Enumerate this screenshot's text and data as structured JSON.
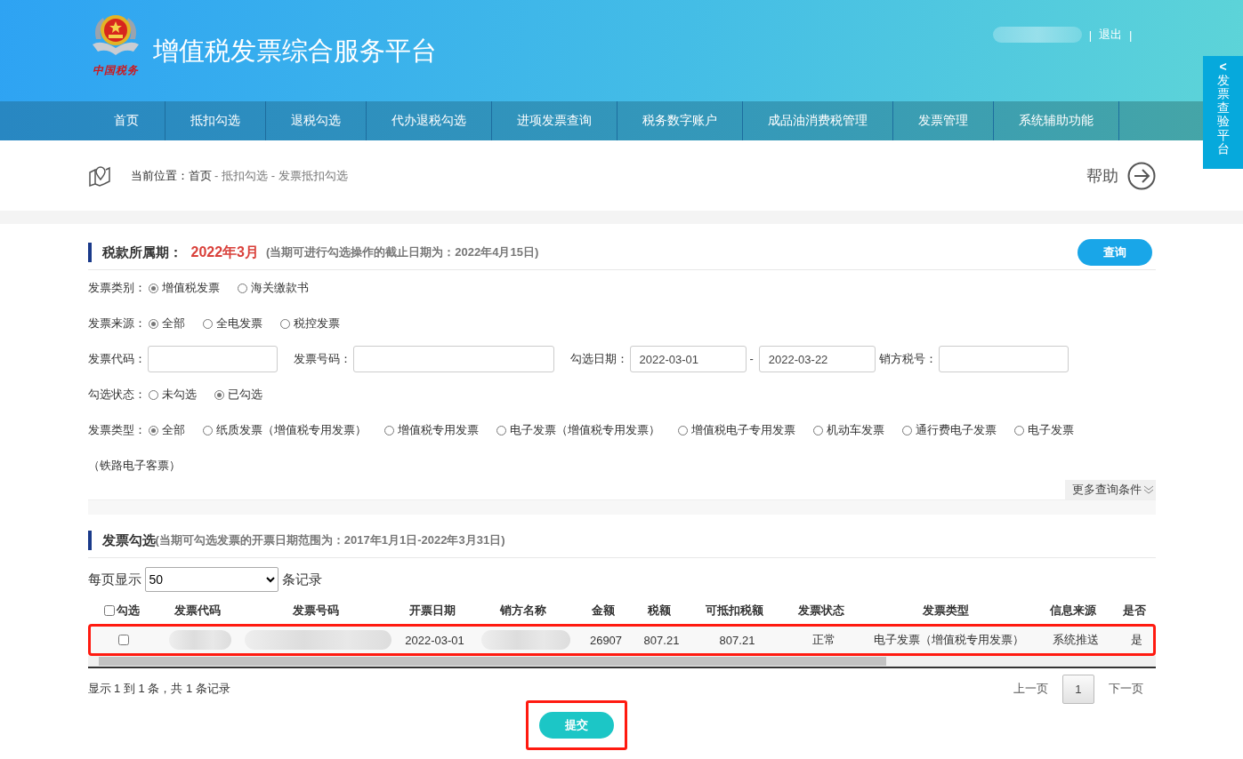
{
  "header": {
    "logo_text": "中国税务",
    "title": "增值税发票综合服务平台",
    "user_links": [
      {
        "separator": "|",
        "label": "退出",
        "trailing": "|"
      }
    ]
  },
  "side_tab": {
    "arrow": "<",
    "label": "发票查验平台"
  },
  "nav": [
    {
      "label": "首页",
      "selected": false
    },
    {
      "label": "抵扣勾选",
      "selected": false
    },
    {
      "label": "退税勾选",
      "selected": false
    },
    {
      "label": "代办退税勾选",
      "selected": false
    },
    {
      "label": "进项发票查询",
      "selected": false
    },
    {
      "label": "税务数字账户",
      "selected": false
    },
    {
      "label": "成品油消费税管理",
      "selected": false
    },
    {
      "label": "发票管理",
      "selected": false
    },
    {
      "label": "系统辅助功能",
      "selected": false
    }
  ],
  "breadcrumb": {
    "prefix": "当前位置：",
    "items": [
      "首页",
      "抵扣勾选",
      "发票抵扣勾选"
    ],
    "separator": " - ",
    "help": "帮助"
  },
  "period": {
    "label": "税款所属期：",
    "value": "2022年3月",
    "note": "(当期可进行勾选操作的截止日期为：2022年4月15日)",
    "query_button": "查询"
  },
  "filters": [
    {
      "kind": "radio",
      "label": "发票类别：",
      "options": [
        {
          "label": "增值税发票",
          "selected": true
        },
        {
          "label": "海关缴款书",
          "selected": false
        }
      ]
    },
    {
      "kind": "radio",
      "label": "发票来源：",
      "options": [
        {
          "label": "全部",
          "selected": true
        },
        {
          "label": "全电发票",
          "selected": false
        },
        {
          "label": "税控发票",
          "selected": false
        }
      ]
    },
    {
      "kind": "fields",
      "items": [
        {
          "kind": "text",
          "label": "发票代码："
        },
        {
          "kind": "text",
          "label": "发票号码："
        },
        {
          "kind": "date_range",
          "label": "勾选日期：",
          "from": "2022-03-01",
          "separator": "-",
          "to": "2022-03-22"
        },
        {
          "kind": "text",
          "label": "销方税号："
        }
      ]
    },
    {
      "kind": "radio",
      "label": "勾选状态：",
      "options": [
        {
          "label": "未勾选",
          "selected": false
        },
        {
          "label": "已勾选",
          "selected": true
        }
      ]
    },
    {
      "kind": "radio",
      "label": "发票类型：",
      "options": [
        {
          "label": "全部",
          "selected": true
        },
        {
          "label": "纸质发票（增值税专用发票）",
          "selected": false
        },
        {
          "label": "增值税专用发票",
          "selected": false
        },
        {
          "label": "电子发票（增值税专用发票）",
          "selected": false
        },
        {
          "label": "增值税电子专用发票",
          "selected": false
        },
        {
          "label": "机动车发票",
          "selected": false
        },
        {
          "label": "通行费电子发票",
          "selected": false
        },
        {
          "label": "电子发票",
          "continuation": "（铁路电子客票）",
          "selected": false
        }
      ]
    }
  ],
  "more_conditions": "更多查询条件",
  "selection": {
    "title": "发票勾选",
    "note": "(当期可勾选发票的开票日期范围为：2017年1月1日-2022年3月31日)",
    "page_size_prefix": "每页显示",
    "page_size": "50",
    "page_size_suffix": "条记录"
  },
  "table": {
    "select_all": {
      "label": "勾选",
      "checked": false
    },
    "columns": [
      "发票代码",
      "发票号码",
      "开票日期",
      "销方名称",
      "金额",
      "税额",
      "可抵扣税额",
      "发票状态",
      "发票类型",
      "信息来源",
      "是否"
    ],
    "rows": [
      {
        "checked": false,
        "highlighted": true,
        "cells": [
          {
            "kind": "blurred"
          },
          {
            "kind": "blurred"
          },
          {
            "kind": "text",
            "text": "2022-03-01"
          },
          {
            "kind": "blurred"
          },
          {
            "kind": "text",
            "text": "26907"
          },
          {
            "kind": "text",
            "text": "807.21"
          },
          {
            "kind": "text",
            "text": "807.21"
          },
          {
            "kind": "text",
            "text": "正常"
          },
          {
            "kind": "text",
            "text": "电子发票（增值税专用发票）"
          },
          {
            "kind": "text",
            "text": "系统推送"
          },
          {
            "kind": "text",
            "text": "是"
          }
        ]
      }
    ]
  },
  "footer": {
    "summary": "显示 1 到 1 条，共 1 条记录",
    "prev": "上一页",
    "pages": [
      {
        "label": "1",
        "selected": true
      }
    ],
    "next": "下一页"
  },
  "submit": {
    "label": "提交",
    "highlighted": true
  }
}
